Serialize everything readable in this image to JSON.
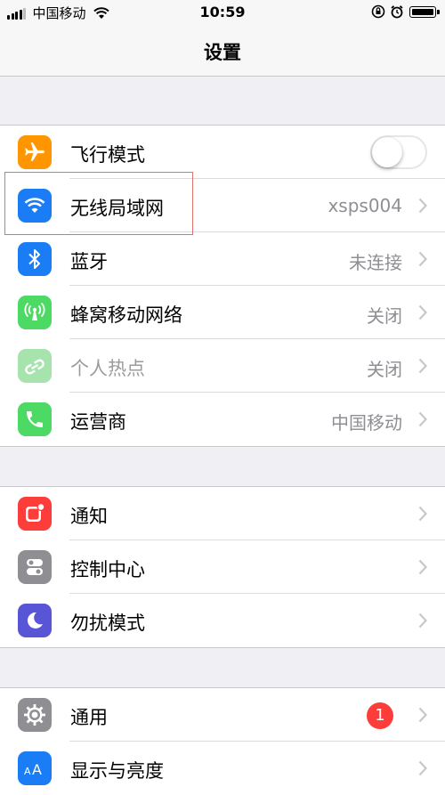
{
  "status_bar": {
    "carrier": "中国移动",
    "time": "10:59"
  },
  "nav": {
    "title": "设置"
  },
  "groups": [
    {
      "items": [
        {
          "label": "飞行模式",
          "icon": "airplane-icon",
          "icon_color": "#ff9500",
          "control": "toggle",
          "toggle_on": false
        },
        {
          "label": "无线局域网",
          "icon": "wifi-icon",
          "icon_color": "#1a7df5",
          "value": "xsps004"
        },
        {
          "label": "蓝牙",
          "icon": "bluetooth-icon",
          "icon_color": "#1a7df5",
          "value": "未连接"
        },
        {
          "label": "蜂窝移动网络",
          "icon": "cellular-icon",
          "icon_color": "#4cd964",
          "value": "关闭"
        },
        {
          "label": "个人热点",
          "icon": "hotspot-icon",
          "icon_color": "#a6e3ad",
          "value": "关闭",
          "dimmed": true
        },
        {
          "label": "运营商",
          "icon": "phone-icon",
          "icon_color": "#4cd964",
          "value": "中国移动"
        }
      ]
    },
    {
      "items": [
        {
          "label": "通知",
          "icon": "notifications-icon",
          "icon_color": "#fc3d39"
        },
        {
          "label": "控制中心",
          "icon": "control-center-icon",
          "icon_color": "#8e8e93"
        },
        {
          "label": "勿扰模式",
          "icon": "moon-icon",
          "icon_color": "#5856d6"
        }
      ]
    },
    {
      "items": [
        {
          "label": "通用",
          "icon": "gear-icon",
          "icon_color": "#8e8e93",
          "badge": "1"
        },
        {
          "label": "显示与亮度",
          "icon": "display-brightness-icon",
          "icon_color": "#1a7df5"
        }
      ]
    }
  ]
}
